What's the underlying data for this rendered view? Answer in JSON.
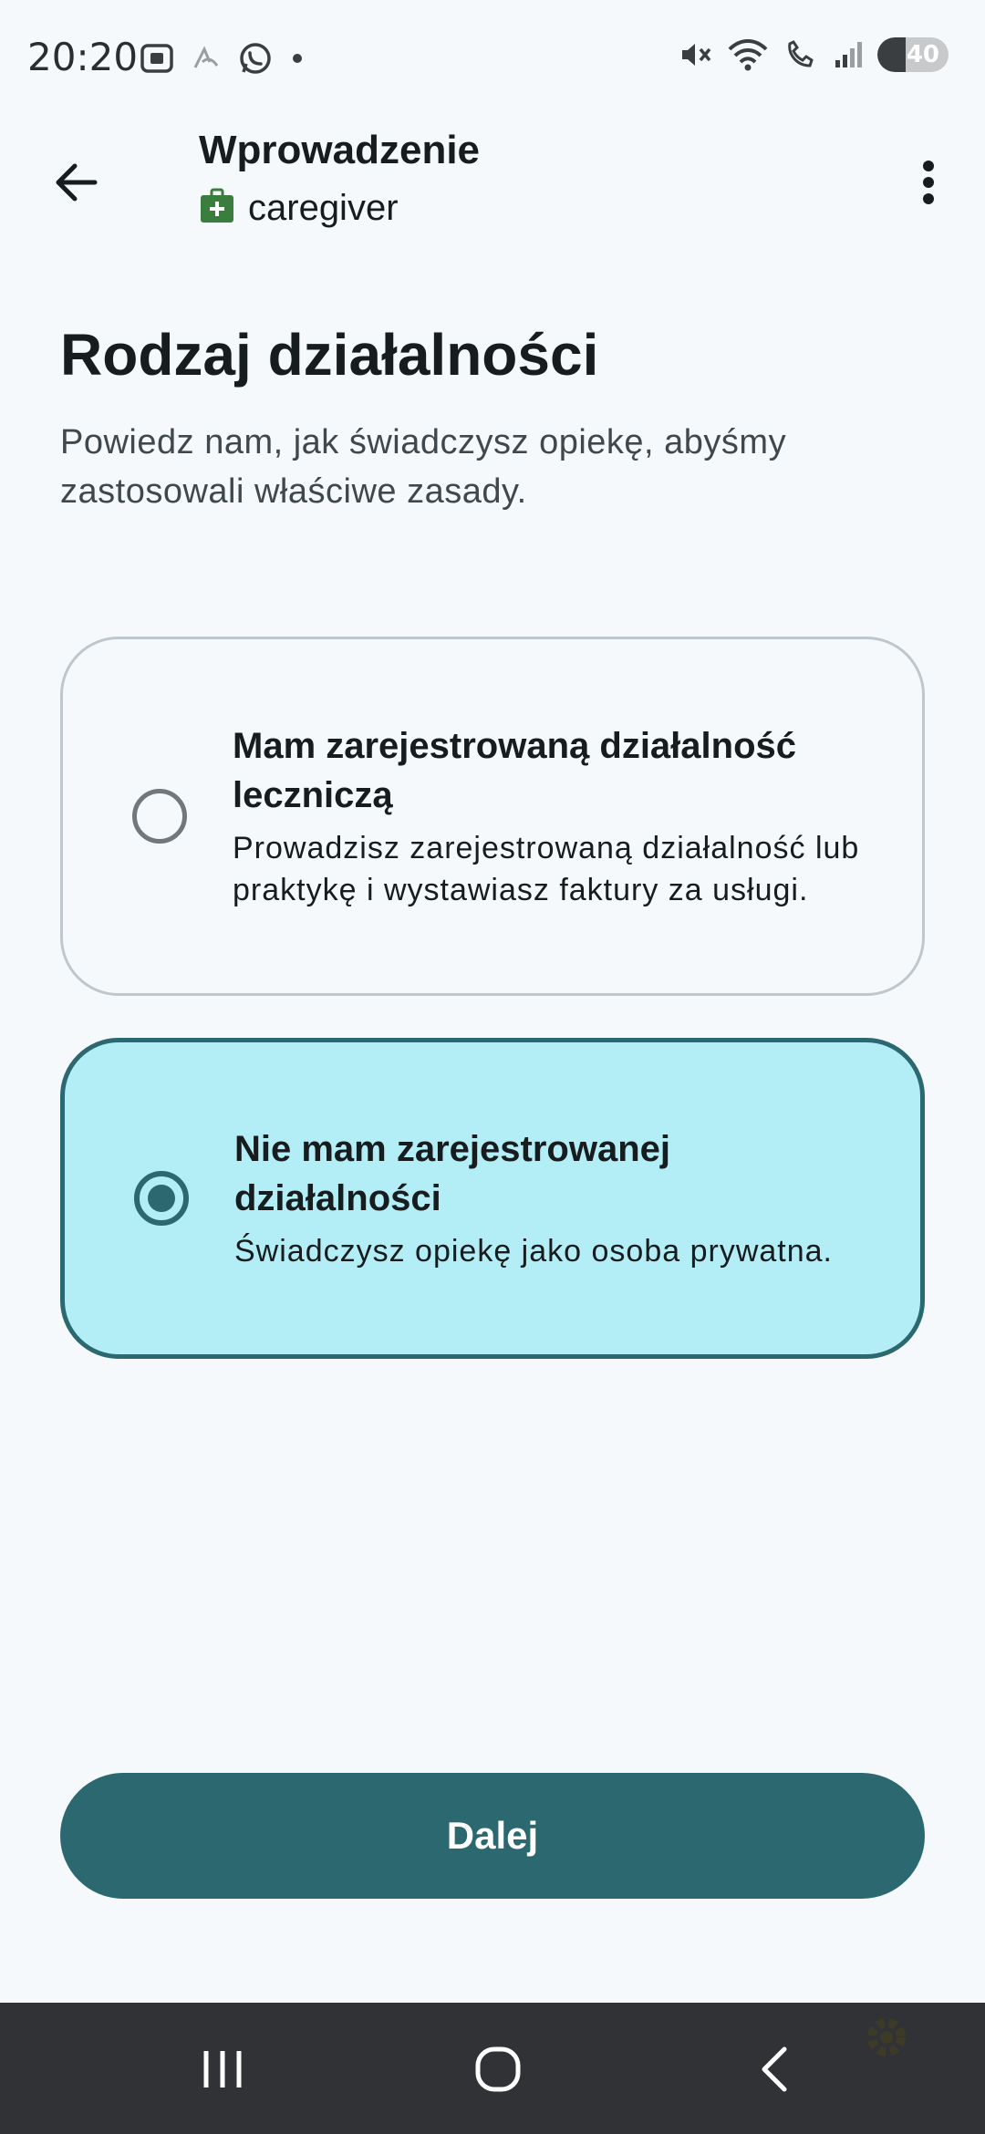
{
  "status_bar": {
    "time": "20:20",
    "battery": "40",
    "battery_level": 0.4,
    "left_icons": [
      "screenshot-icon",
      "ai-icon",
      "whatsapp-icon",
      "notification-dot-icon"
    ],
    "right_icons": [
      "mute-icon",
      "wifi-icon",
      "wifi-calling-icon",
      "signal-icon",
      "battery-icon"
    ]
  },
  "app_bar": {
    "title": "Wprowadzenie",
    "subtitle": "caregiver",
    "subtitle_icon": "medical-bag-icon",
    "back_icon": "arrow-back-icon",
    "menu_icon": "more-vert-icon"
  },
  "content": {
    "heading": "Rodzaj działalności",
    "subheading": "Powiedz nam, jak świadczysz opiekę, abyśmy zastosowali właściwe zasady."
  },
  "options": [
    {
      "title": "Mam zarejestrowaną działalność leczniczą",
      "description": "Prowadzisz zarejestrowaną działalność lub praktykę i wystawiasz faktury za usługi.",
      "selected": false
    },
    {
      "title": "Nie mam zarejestrowanej działalności",
      "description": "Świadczysz opiekę jako osoba prywatna.",
      "selected": true
    }
  ],
  "next_button": {
    "label": "Dalej"
  },
  "colors": {
    "primary": "#2b6870",
    "selected_card": "#b3edf5",
    "background": "#f5f9fb",
    "icon_green": "#3b7d3e"
  },
  "nav_bar": {
    "icons": [
      "recents-icon",
      "home-icon",
      "back-icon"
    ]
  }
}
